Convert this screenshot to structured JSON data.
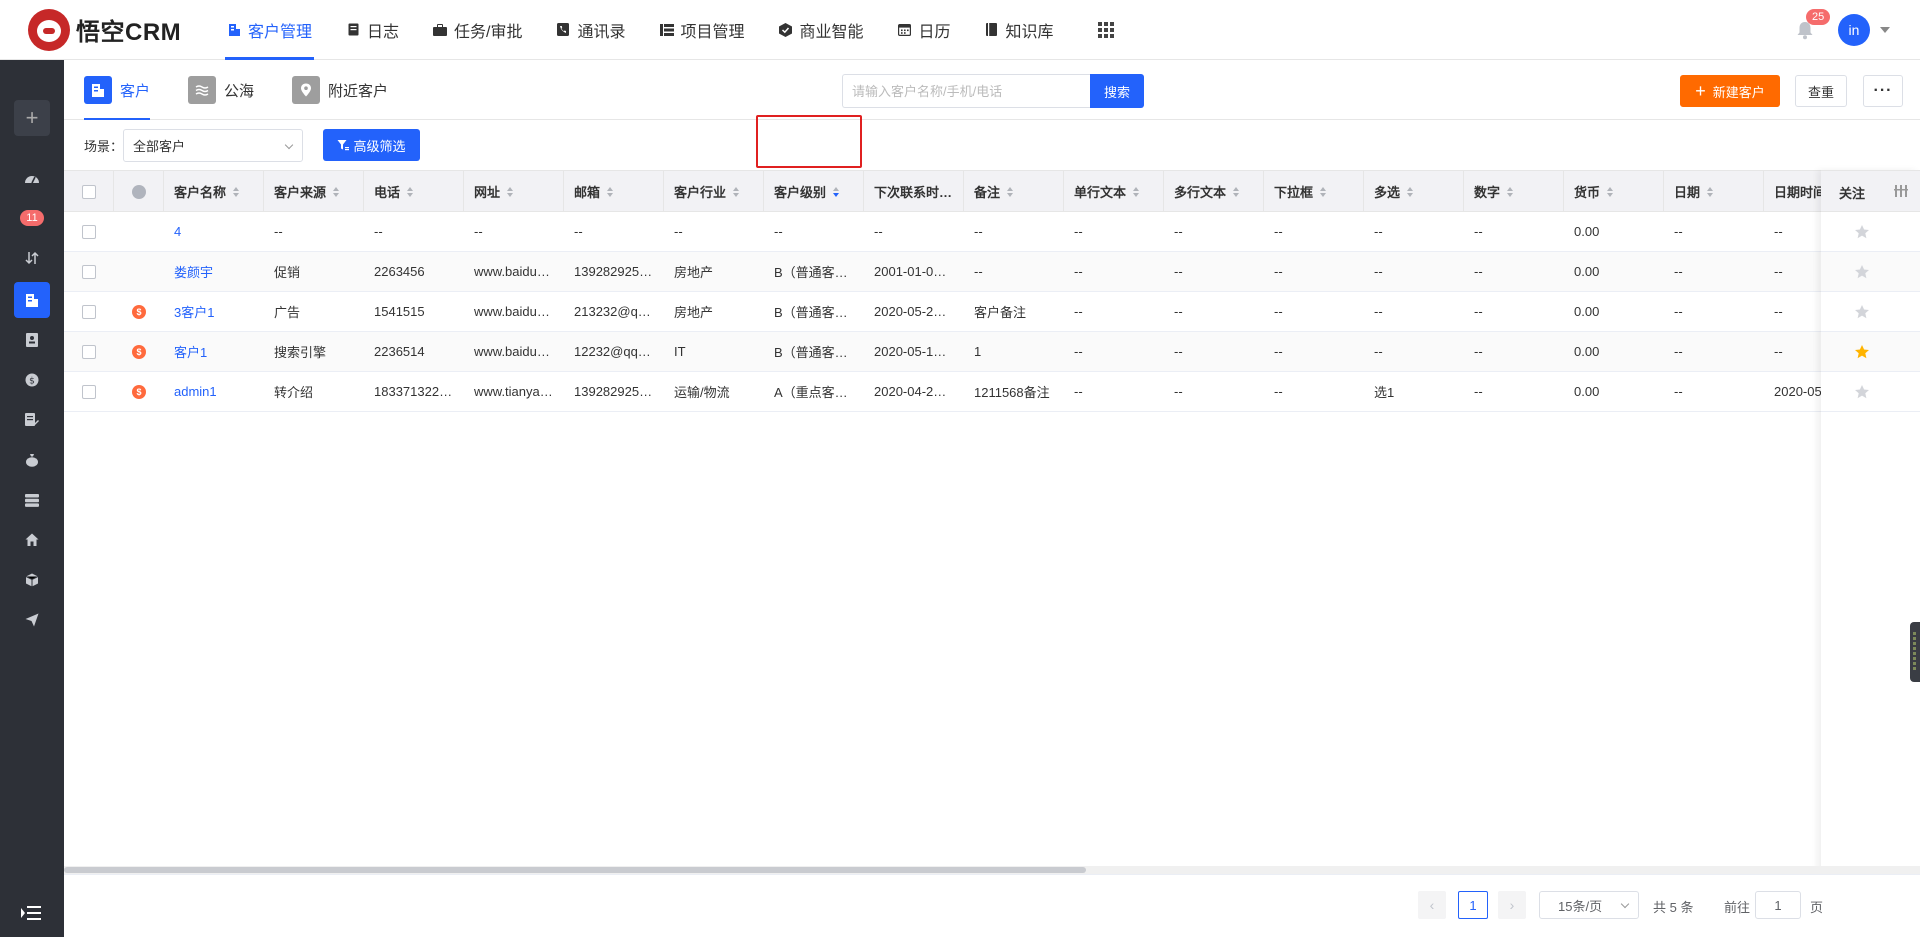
{
  "app": {
    "logo_text": "悟空CRM"
  },
  "nav": [
    {
      "label": "客户管理",
      "icon": "building-icon",
      "active": true
    },
    {
      "label": "日志",
      "icon": "log-icon"
    },
    {
      "label": "任务/审批",
      "icon": "briefcase-icon"
    },
    {
      "label": "通讯录",
      "icon": "phone-book-icon"
    },
    {
      "label": "项目管理",
      "icon": "project-icon"
    },
    {
      "label": "商业智能",
      "icon": "bi-icon"
    },
    {
      "label": "日历",
      "icon": "calendar-icon"
    },
    {
      "label": "知识库",
      "icon": "book-icon"
    }
  ],
  "header": {
    "notification_count": "25",
    "avatar_text": "in"
  },
  "sidebar": {
    "badge_count": "11"
  },
  "tabs": [
    {
      "label": "客户",
      "active": true
    },
    {
      "label": "公海"
    },
    {
      "label": "附近客户"
    }
  ],
  "search": {
    "placeholder": "请输入客户名称/手机/电话",
    "button_label": "搜索"
  },
  "toolbar": {
    "new_label": "新建客户",
    "dup_check_label": "查重",
    "more_label": "···"
  },
  "filter": {
    "scene_label": "场景：",
    "scene_value": "全部客户",
    "advanced_label": "高级筛选"
  },
  "columns": [
    "客户名称",
    "客户来源",
    "电话",
    "网址",
    "邮箱",
    "客户行业",
    "客户级别",
    "下次联系时…",
    "备注",
    "单行文本",
    "多行文本",
    "下拉框",
    "多选",
    "数字",
    "货币",
    "日期",
    "日期时间"
  ],
  "follow_column_label": "关注",
  "rows": [
    {
      "deal": false,
      "name": "4",
      "cells": [
        "--",
        "--",
        "--",
        "--",
        "--",
        "--",
        "--",
        "--",
        "--",
        "--",
        "--",
        "--",
        "--",
        "0.00",
        "--",
        "--"
      ],
      "starred": false
    },
    {
      "deal": false,
      "name": "娄颜宇",
      "cells": [
        "促销",
        "2263456",
        "www.baidu…",
        "139282925…",
        "房地产",
        "B（普通客…",
        "2001-01-0…",
        "--",
        "--",
        "--",
        "--",
        "--",
        "--",
        "0.00",
        "--",
        "--"
      ],
      "starred": false
    },
    {
      "deal": true,
      "name": "3客户1",
      "cells": [
        "广告",
        "1541515",
        "www.baidu…",
        "213232@q…",
        "房地产",
        "B（普通客…",
        "2020-05-2…",
        "客户备注",
        "--",
        "--",
        "--",
        "--",
        "--",
        "0.00",
        "--",
        "--"
      ],
      "starred": false
    },
    {
      "deal": true,
      "name": "客户1",
      "cells": [
        "搜索引擎",
        "2236514",
        "www.baidu…",
        "12232@qq…",
        "IT",
        "B（普通客…",
        "2020-05-1…",
        "1",
        "--",
        "--",
        "--",
        "--",
        "--",
        "0.00",
        "--",
        "--"
      ],
      "starred": true
    },
    {
      "deal": true,
      "name": "admin1",
      "cells": [
        "转介绍",
        "183371322…",
        "www.tianya…",
        "139282925…",
        "运输/物流",
        "A（重点客…",
        "2020-04-2…",
        "1211568备注",
        "--",
        "--",
        "--",
        "选1",
        "--",
        "0.00",
        "--",
        "2020-05-"
      ],
      "starred": false
    }
  ],
  "pagination": {
    "current_page": "1",
    "page_size": "15条/页",
    "total": "共 5 条",
    "goto_label": "前往",
    "goto_value": "1",
    "page_unit": "页"
  },
  "colors": {
    "primary": "#2362fb",
    "accent_orange": "#ff6a00",
    "sidebar_bg": "#2d3037",
    "star_active": "#ffb400"
  }
}
